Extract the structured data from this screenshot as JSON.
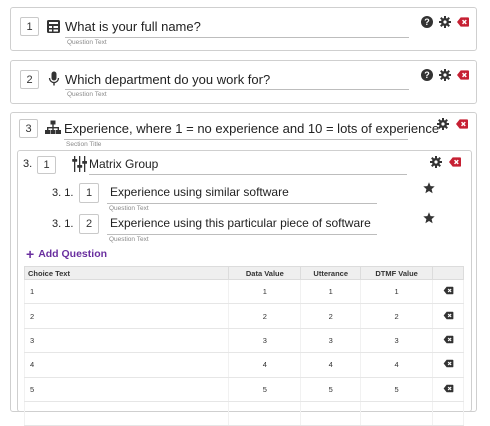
{
  "colors": {
    "accent": "#6a2f9f",
    "delete": "#c62033",
    "dark_icon": "#333333"
  },
  "questions": [
    {
      "number": "1",
      "text": "What is your full name?",
      "sublabel": "Question Text",
      "icon": "form-icon"
    },
    {
      "number": "2",
      "text": "Which department do you work for?",
      "sublabel": "Question Text",
      "icon": "microphone-icon"
    }
  ],
  "section": {
    "number": "3",
    "text": "Experience, where 1 = no experience and 10 = lots of experience",
    "sublabel": "Section Title",
    "icon": "tree-icon"
  },
  "matrix": {
    "prefix": "3.",
    "number": "1",
    "text": "Matrix Group",
    "icon": "sliders-icon",
    "items": [
      {
        "prefix": "3. 1.",
        "number": "1",
        "text": "Experience using similar software",
        "sublabel": "Question Text"
      },
      {
        "prefix": "3. 1.",
        "number": "2",
        "text": "Experience using this particular piece of software",
        "sublabel": "Question Text"
      }
    ],
    "add_question_label": "Add Question"
  },
  "choices": {
    "headers": [
      "Choice Text",
      "Data Value",
      "Utterance",
      "DTMF Value",
      ""
    ],
    "rows": [
      [
        "1",
        "1",
        "1",
        "1"
      ],
      [
        "2",
        "2",
        "2",
        "2"
      ],
      [
        "3",
        "3",
        "3",
        "3"
      ],
      [
        "4",
        "4",
        "4",
        "4"
      ],
      [
        "5",
        "5",
        "5",
        "5"
      ],
      [
        "",
        "",
        "",
        ""
      ]
    ]
  }
}
